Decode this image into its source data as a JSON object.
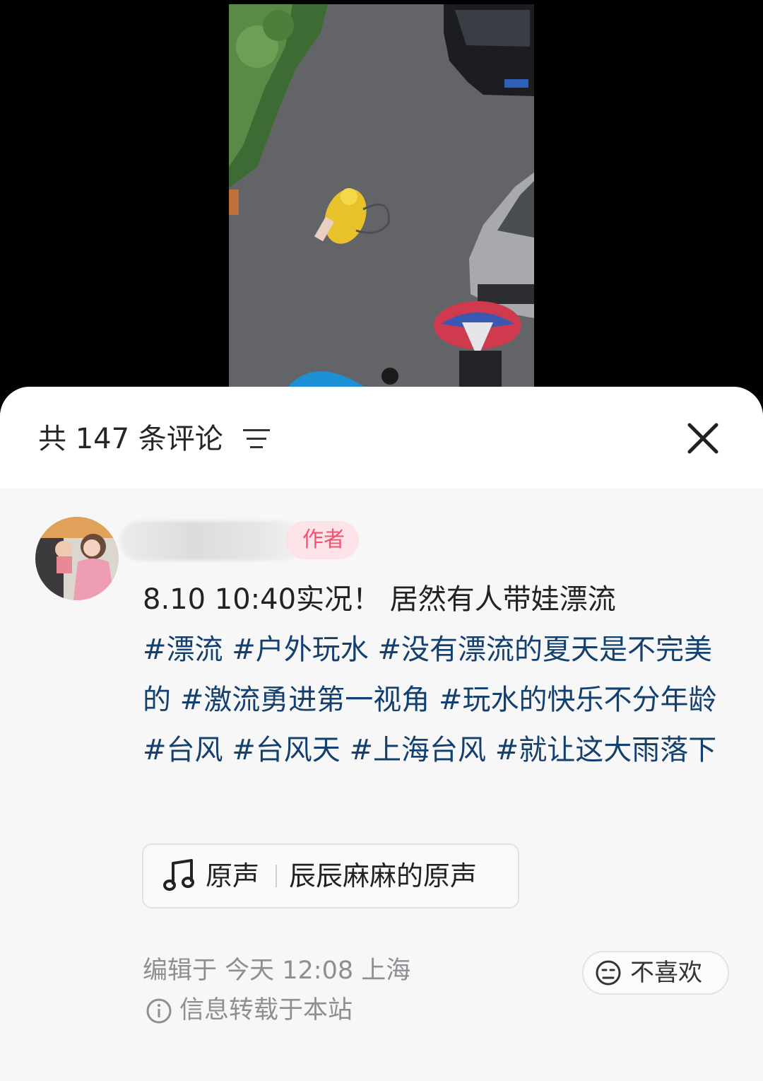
{
  "header": {
    "comment_count": "共 147 条评论",
    "sort_icon": "sort-lines-icon",
    "close_icon": "close-x-icon"
  },
  "comment": {
    "author_badge": "作者",
    "text": "8.10 10:40实况！ 居然有人带娃漂流",
    "hashtags": [
      "#漂流",
      "#户外玩水",
      "#没有漂流的夏天是不完美的",
      "#激流勇进第一视角",
      "#玩水的快乐不分年龄",
      "#台风",
      "#台风天",
      "#上海台风",
      "#就让这大雨落下"
    ],
    "music": {
      "label": "原声",
      "title": "辰辰麻麻的原声"
    },
    "meta": "编辑于  今天 12:08  上海",
    "source_note": "信息转载于本站",
    "dislike_label": "不喜欢"
  },
  "colors": {
    "hashtag": "#14406e",
    "badge_text": "#f0526f",
    "badge_bg": "#fbe3e7"
  }
}
